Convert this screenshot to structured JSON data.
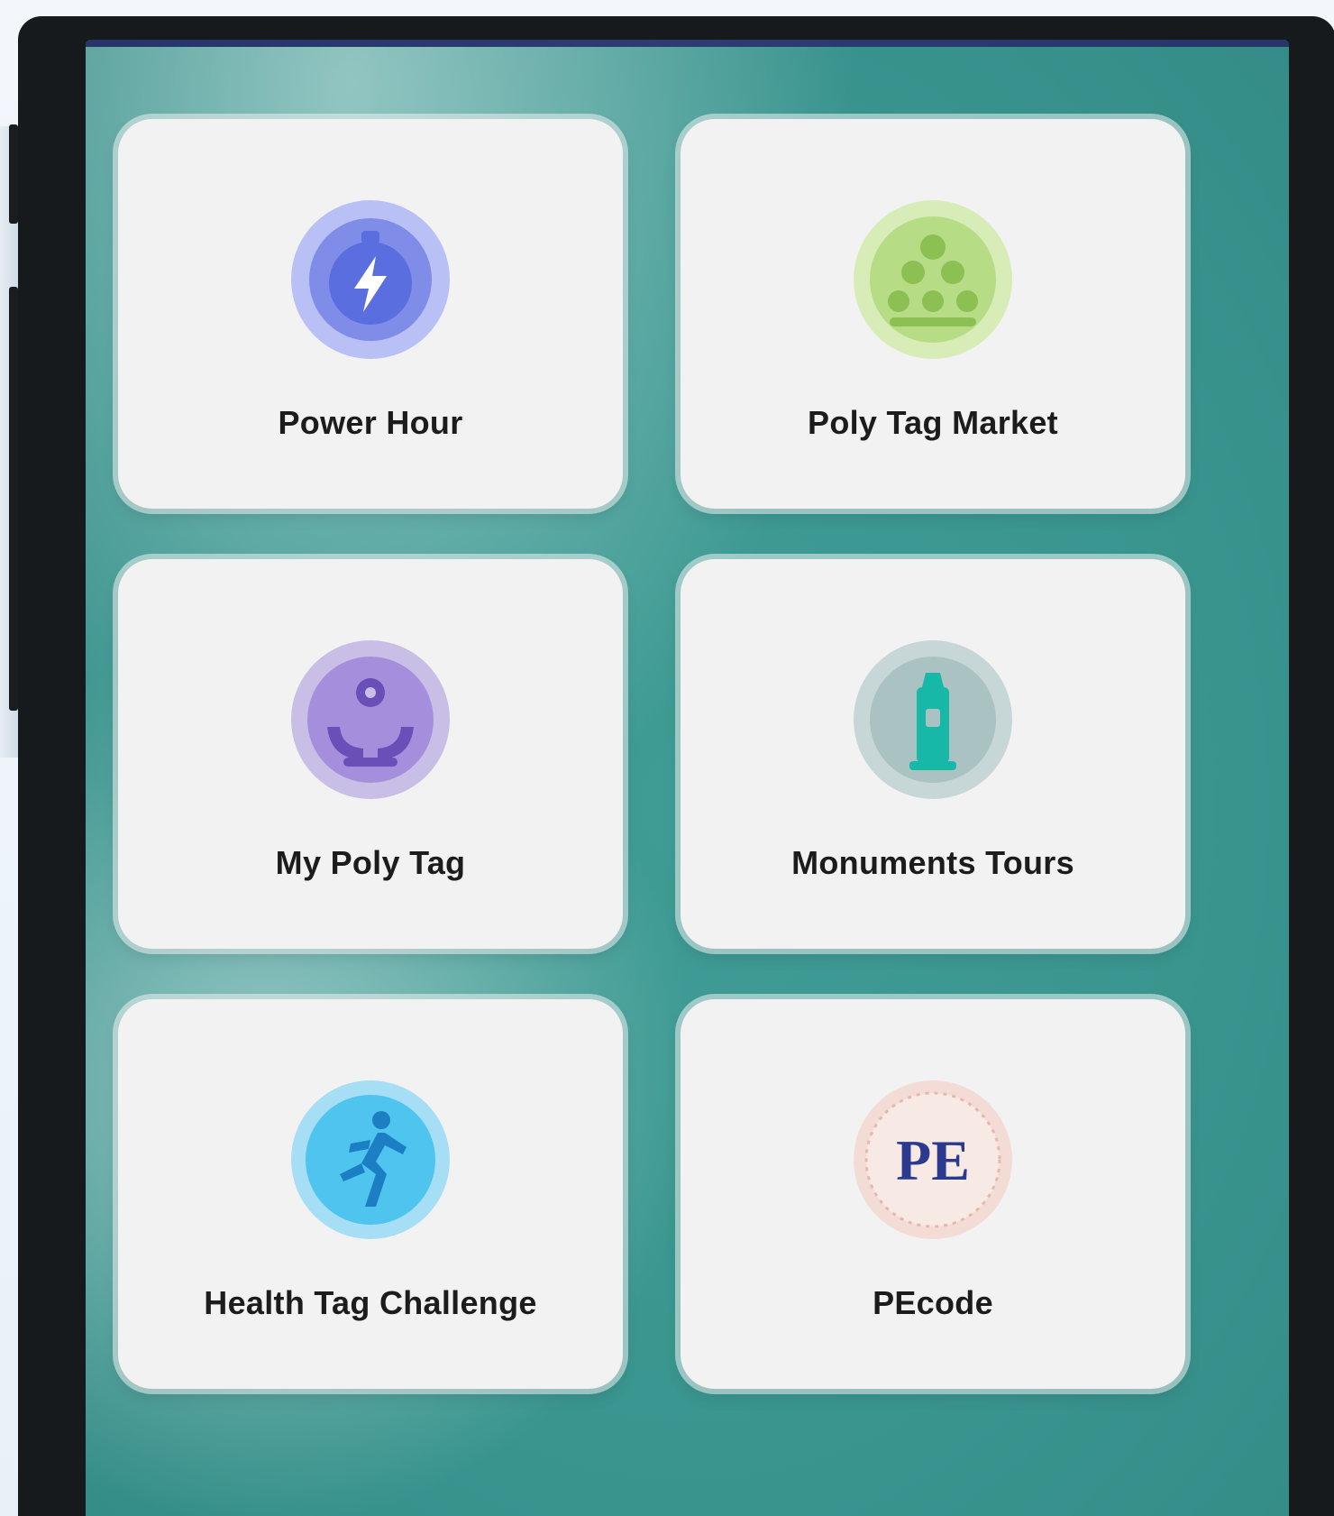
{
  "tiles": [
    {
      "label": "Power Hour",
      "icon": "lightning-bolt-icon",
      "color": "#5b6ee0"
    },
    {
      "label": "Poly Tag Market",
      "icon": "market-icon",
      "color": "#9ccf5e"
    },
    {
      "label": "My Poly Tag",
      "icon": "hands-holding-icon",
      "color": "#8a6fd0"
    },
    {
      "label": "Monuments Tours",
      "icon": "lighthouse-icon",
      "color": "#18b8a8"
    },
    {
      "label": "Health Tag Challenge",
      "icon": "runner-icon",
      "color": "#29b3ea"
    },
    {
      "label": "PEcode",
      "icon": "pecode-logo-icon",
      "color": "#2b3a8f",
      "logo_text": "PE"
    }
  ],
  "colors": {
    "background_teal": "#3a958f",
    "tile_background": "#f2f2f3",
    "phone_frame": "#161a1c"
  }
}
